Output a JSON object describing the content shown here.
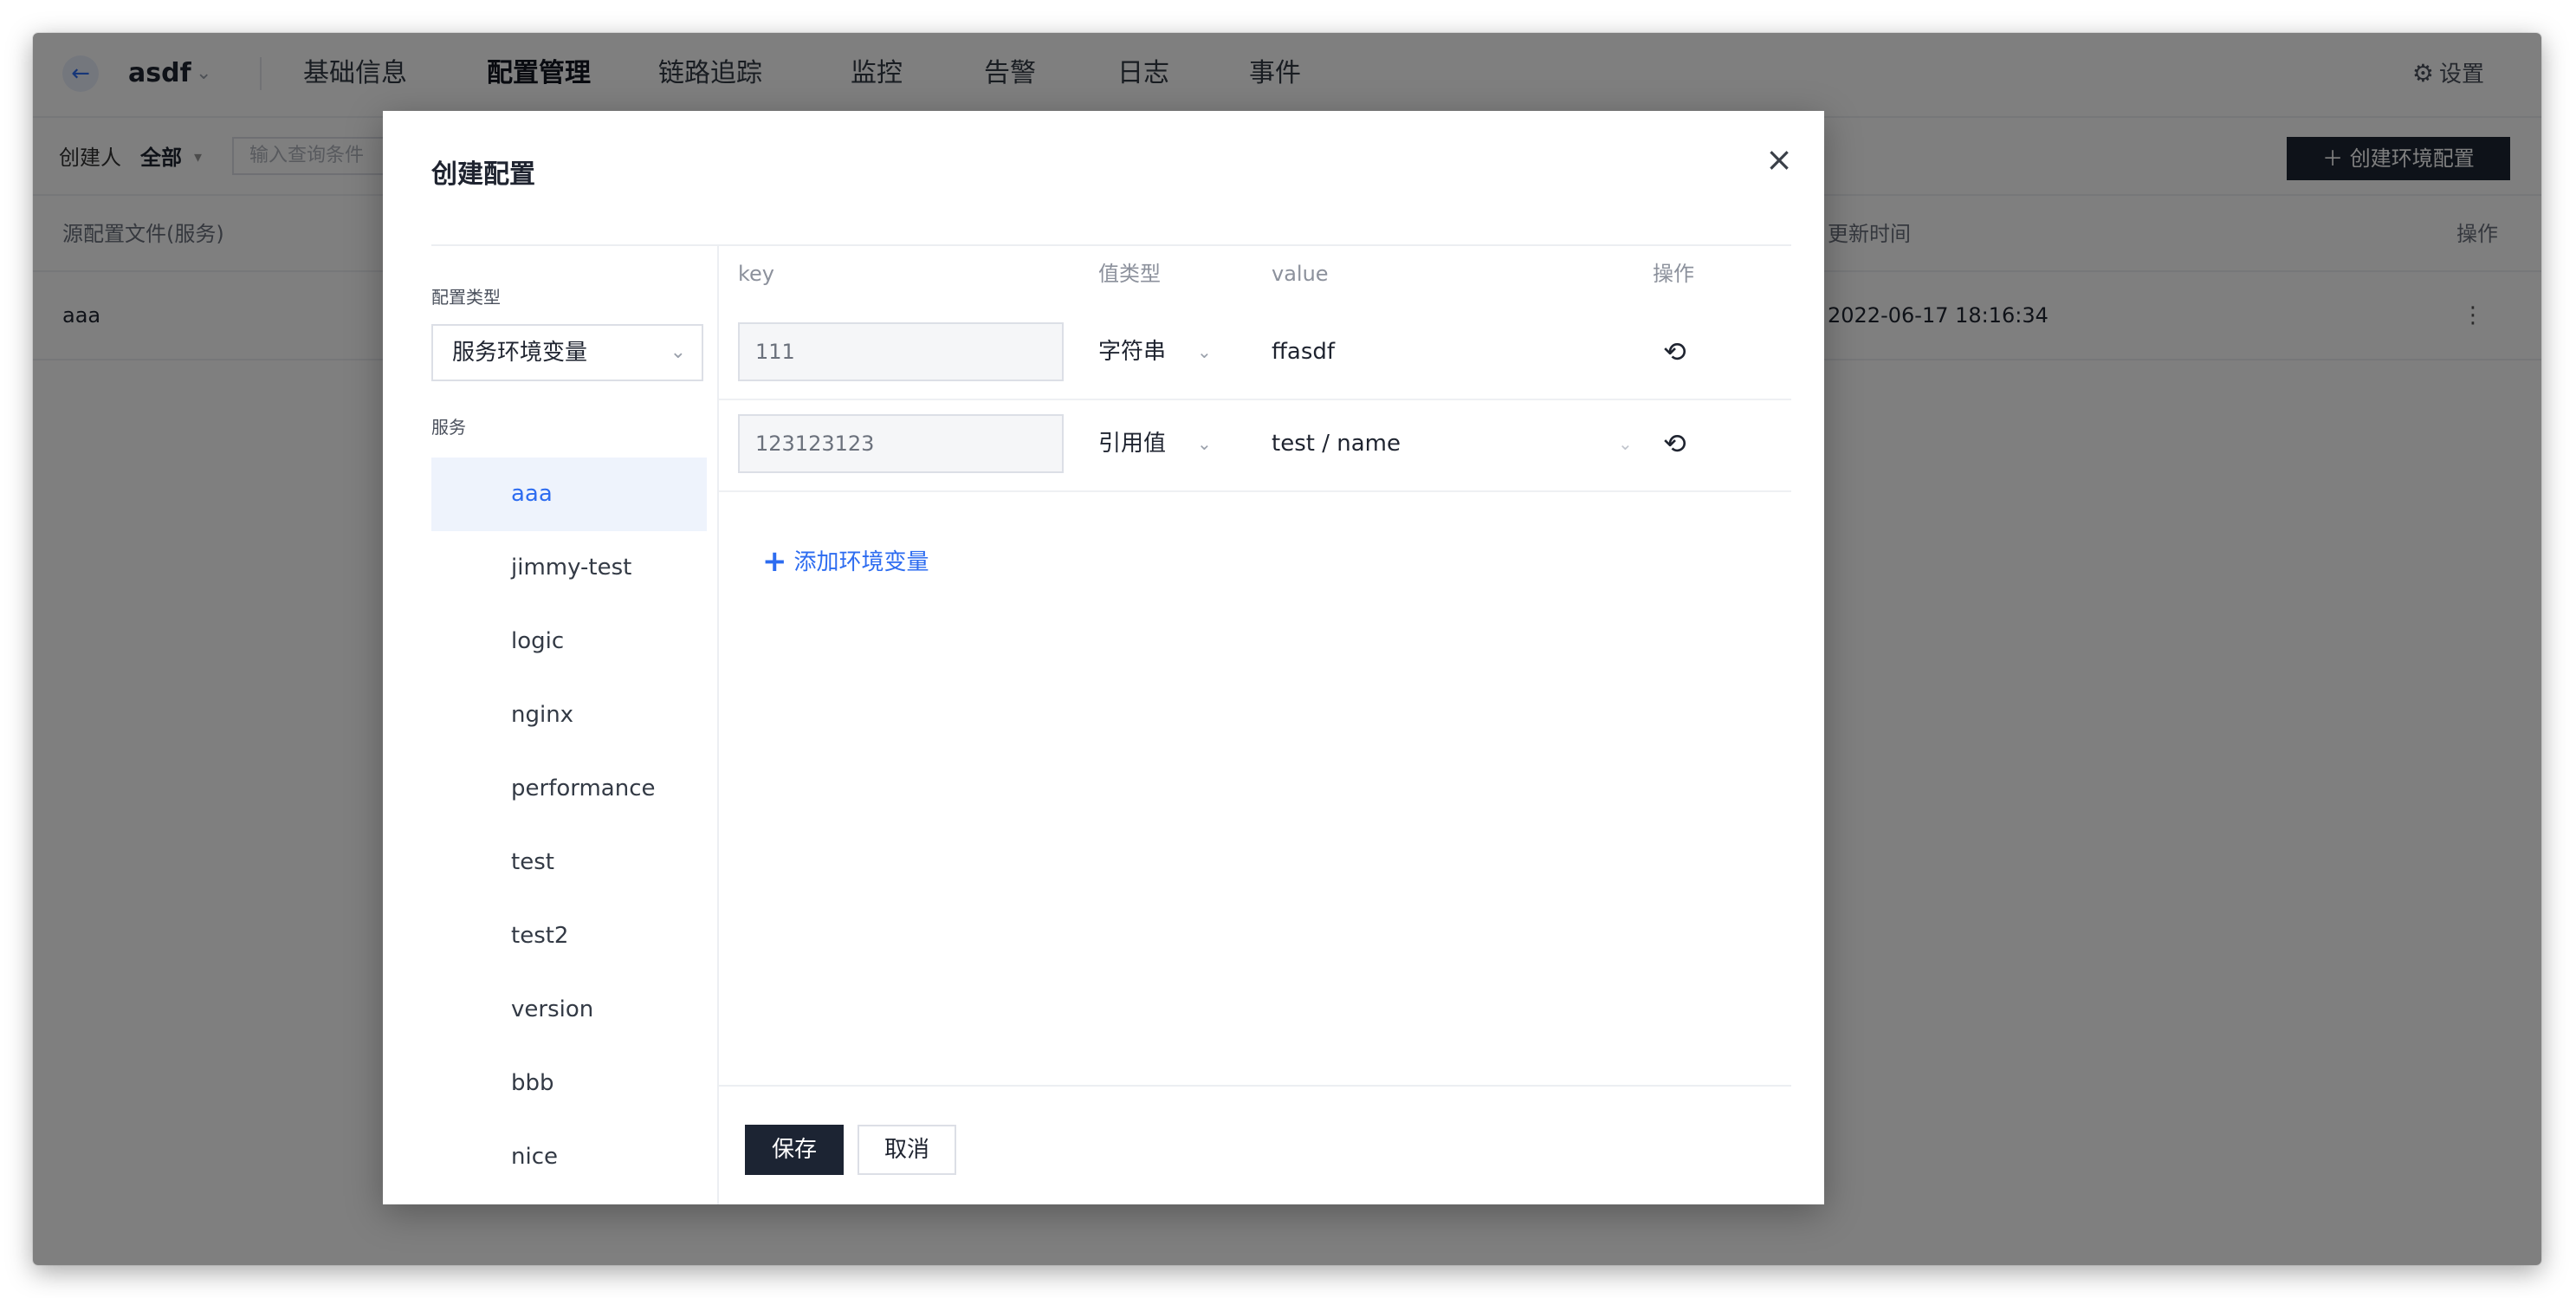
{
  "header": {
    "back_icon": "arrow-left-icon",
    "app_name": "asdf",
    "app_chevron": "⌄",
    "tabs": [
      {
        "label": "基础信息"
      },
      {
        "label": "配置管理"
      },
      {
        "label": "链路追踪"
      },
      {
        "label": "监控"
      },
      {
        "label": "告警"
      },
      {
        "label": "日志"
      },
      {
        "label": "事件"
      }
    ],
    "active_tab": "配置管理",
    "settings_label": "设置"
  },
  "filter": {
    "creator_label": "创建人",
    "creator_value": "全部",
    "search_placeholder": "输入查询条件",
    "create_button_label": "＋ 创建环境配置"
  },
  "table": {
    "columns": [
      "源配置文件(服务)",
      "更新时间",
      "操作"
    ],
    "rows": [
      {
        "name": "aaa",
        "updated": "2022-06-17 18:16:34",
        "menu": "⋮"
      }
    ]
  },
  "modal": {
    "title": "创建配置",
    "close_symbol": "×",
    "config_type_label": "配置类型",
    "config_type_value": "服务环境变量",
    "services_label": "服务",
    "services": [
      "aaa",
      "jimmy-test",
      "logic",
      "nginx",
      "performance",
      "test",
      "test2",
      "version",
      "bbb",
      "nice"
    ],
    "selected_service": "aaa",
    "columns": {
      "key": "key",
      "type": "值类型",
      "value": "value",
      "action": "操作"
    },
    "rows": [
      {
        "key": "111",
        "type": "字符串",
        "value": "ffasdf"
      },
      {
        "key": "123123123",
        "type": "引用值",
        "value": "test / name"
      }
    ],
    "add_label": "添加环境变量",
    "save_label": "保存",
    "cancel_label": "取消"
  },
  "colors": {
    "primary": "#1c2433",
    "accent": "#2d6cf0",
    "overlay": "rgba(0,0,0,0.5)"
  }
}
